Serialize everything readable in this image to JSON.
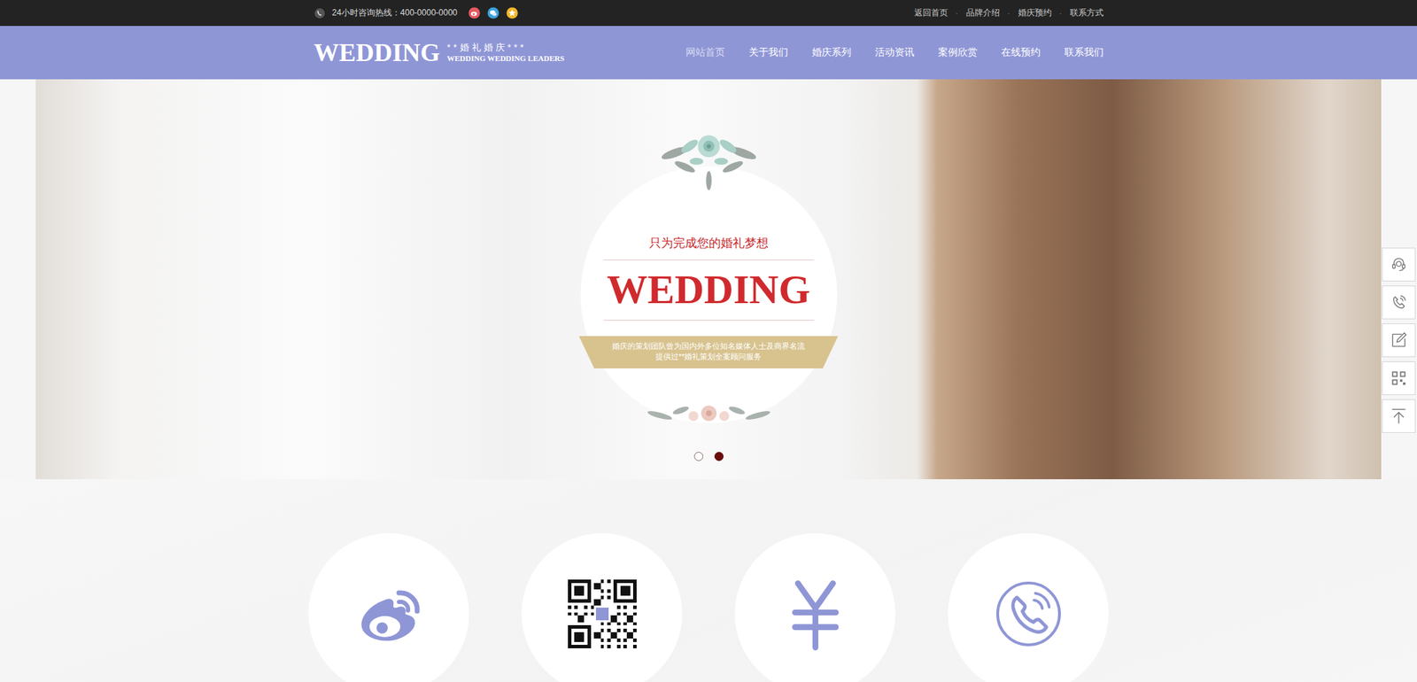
{
  "topbar": {
    "hotline": "24小时咨询热线：400-0000-0000",
    "links": [
      "返回首页",
      "品牌介绍",
      "婚庆预约",
      "联系方式"
    ],
    "separator": "·"
  },
  "logo": {
    "main": "WEDDING",
    "tagline": "**婚礼婚庆***",
    "sub": "WEDDING WEDDING LEADERS"
  },
  "nav": [
    {
      "label": "网站首页",
      "selected": true
    },
    {
      "label": "关于我们",
      "selected": false
    },
    {
      "label": "婚庆系列",
      "selected": false
    },
    {
      "label": "活动资讯",
      "selected": false
    },
    {
      "label": "案例欣赏",
      "selected": false
    },
    {
      "label": "在线预约",
      "selected": false
    },
    {
      "label": "联系我们",
      "selected": false
    }
  ],
  "banner": {
    "slogan": "只为完成您的婚礼梦想",
    "title": "WEDDING",
    "description": [
      "婚庆的策划团队曾为国内外多位知名媒体人士及商界名流",
      "提供过**婚礼策划全案顾问服务"
    ],
    "dots": [
      {
        "selected": false
      },
      {
        "selected": true
      }
    ]
  }
}
